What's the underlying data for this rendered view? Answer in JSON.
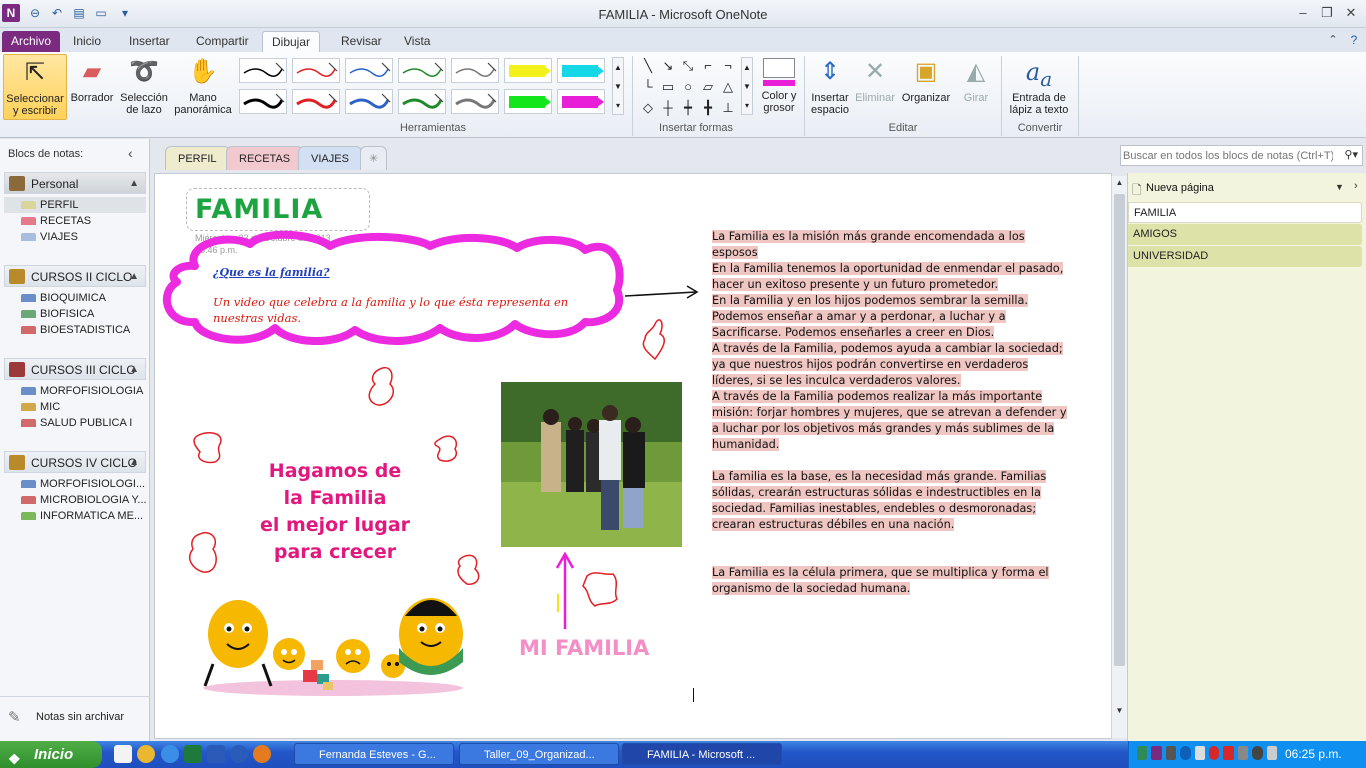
{
  "window": {
    "title": "FAMILIA  -  Microsoft OneNote"
  },
  "ribbon": {
    "tabs": [
      "Archivo",
      "Inicio",
      "Insertar",
      "Compartir",
      "Dibujar",
      "Revisar",
      "Vista"
    ],
    "active_tab": "Dibujar",
    "tools": {
      "select": "Seleccionar y escribir",
      "eraser": "Borrador",
      "lasso": "Selección de lazo",
      "pan": "Mano panorámica"
    },
    "groups": {
      "herramientas": "Herramientas",
      "formas": "Insertar formas",
      "editar": "Editar",
      "convertir": "Convertir"
    },
    "color_size": "Color y grosor",
    "insert_space": "Insertar espacio",
    "delete": "Eliminar",
    "arrange": "Organizar",
    "rotate": "Girar",
    "ink_to_text": "Entrada de lápiz a texto",
    "pen_colors": [
      "#000000",
      "#e02020",
      "#2a62c8",
      "#1f8a2a",
      "#777777",
      "#f2f21a",
      "#16d7e6",
      "#000000",
      "#e02020",
      "#2a62c8",
      "#1f8a2a",
      "#777777",
      "#13e61a",
      "#e81fd7"
    ],
    "accent": "#7a2a7f"
  },
  "notebooks": {
    "header": "Blocs de notas:",
    "list": [
      {
        "name": "Personal",
        "color": "#8a6a3a",
        "sections": [
          {
            "name": "PERFIL",
            "color": "#d8d69a"
          },
          {
            "name": "RECETAS",
            "color": "#e57a8a"
          },
          {
            "name": "VIAJES",
            "color": "#a9bde0"
          }
        ]
      },
      {
        "name": "CURSOS II CICLO",
        "color": "#b88a2a",
        "sections": [
          {
            "name": "BIOQUIMICA",
            "color": "#6a8ec8"
          },
          {
            "name": "BIOFISICA",
            "color": "#6aa87a"
          },
          {
            "name": "BIOESTADISTICA",
            "color": "#d06a6a"
          }
        ]
      },
      {
        "name": "CURSOS III CICLO",
        "color": "#9a3a3a",
        "sections": [
          {
            "name": "MORFOFISIOLOGIA I",
            "color": "#6a8ec8"
          },
          {
            "name": "MIC",
            "color": "#d0a84a"
          },
          {
            "name": "SALUD PUBLICA I",
            "color": "#d06a6a"
          }
        ]
      },
      {
        "name": "CURSOS IV CICLO",
        "color": "#b88a2a",
        "sections": [
          {
            "name": "MORFOFISIOLOGI...",
            "color": "#6a8ec8"
          },
          {
            "name": "MICROBIOLOGIA Y...",
            "color": "#d06a6a"
          },
          {
            "name": "INFORMATICA ME...",
            "color": "#7ab85a"
          }
        ]
      }
    ],
    "unfiled": "Notas sin archivar"
  },
  "section_tabs": [
    "PERFIL",
    "RECETAS",
    "VIAJES"
  ],
  "search": {
    "placeholder": "Buscar en todos los blocs de notas (Ctrl+T)"
  },
  "page": {
    "title": "FAMILIA",
    "date": "Miércoles, 23 de Octubre de 2013",
    "time": "05:46 p.m.",
    "cloud_link": "¿Que es la familia?",
    "cloud_text": "Un video que celebra a la familia y lo que ésta representa en nuestras vidas.",
    "slogan": [
      "Hagamos de",
      "la Familia",
      "el mejor lugar",
      "para crecer"
    ],
    "photo_caption": "MI FAMILIA",
    "paragraphs": [
      [
        "La Familia es la misión más grande encomendada a los",
        "esposos",
        "En la Familia tenemos la oportunidad de enmendar el pasado,",
        "hacer un exitoso presente y un futuro prometedor.",
        "En la Familia y en los hijos podemos sembrar la semilla.",
        "Podemos enseñar a amar y a perdonar, a luchar y a",
        "Sacrificarse. Podemos enseñarles a creer en Dios.",
        "A través de la Familia, podemos ayuda a cambiar la sociedad;",
        "ya que nuestros hijos podrán convertirse en verdaderos",
        "líderes, si se les inculca verdaderos valores.",
        "A través de la Familia podemos realizar la más importante",
        "misión: forjar hombres y mujeres, que se atrevan a defender y",
        "a luchar por los objetivos más grandes y más sublimes de la",
        "humanidad."
      ],
      [
        "La familia es la base, es la necesidad más grande. Familias",
        "sólidas, crearán estructuras sólidas e indestructibles en la",
        "sociedad. Familias inestables, endebles o desmoronadas;",
        "crearan estructuras débiles en una nación."
      ],
      [
        "La Familia es la célula primera, que se multiplica y forma el",
        "organismo de la sociedad humana."
      ]
    ]
  },
  "pages_pane": {
    "new_page": "Nueva página",
    "pages": [
      "FAMILIA",
      "AMIGOS",
      "UNIVERSIDAD"
    ],
    "active": "FAMILIA"
  },
  "taskbar": {
    "start": "Inicio",
    "tasks": [
      "Fernanda Esteves - G...",
      "Taller_09_Organizad...",
      "FAMILIA - Microsoft ..."
    ],
    "clock": "06:25 p.m."
  }
}
